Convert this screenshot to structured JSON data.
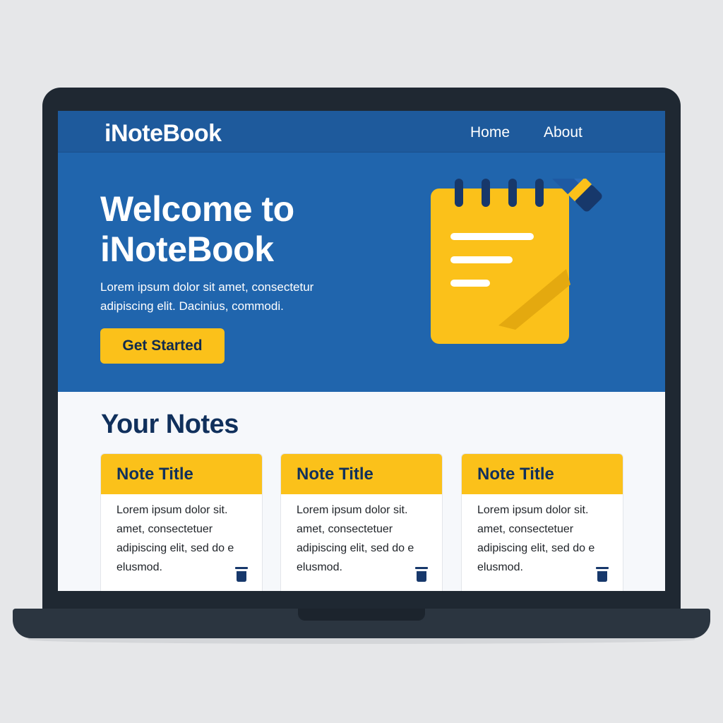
{
  "navbar": {
    "brand": "iNoteBook",
    "links": [
      {
        "label": "Home"
      },
      {
        "label": "About"
      }
    ]
  },
  "hero": {
    "title_line1": "Welcome to",
    "title_line2": "iNoteBook",
    "subtitle": "Lorem ipsum dolor sit amet, consectetur adipiscing elit. Dacinius, commodi.",
    "cta_label": "Get Started",
    "illustration_icon": "notepad-pencil-icon"
  },
  "notes_section": {
    "title": "Your Notes",
    "notes": [
      {
        "title": "Note Title",
        "body": "Lorem ipsum dolor sit. amet, consectetuer adipiscing elit, sed do e elusmod.",
        "action_icon": "trash-icon"
      },
      {
        "title": "Note Title",
        "body": "Lorem ipsum dolor sit. amet, consectetuer adipiscing elit, sed do e elusmod.",
        "action_icon": "trash-icon"
      },
      {
        "title": "Note Title",
        "body": "Lorem ipsum dolor sit. amet, consectetuer adipiscing elit, sed do e elusmod.",
        "action_icon": "trash-icon"
      }
    ]
  },
  "colors": {
    "navbar_bg": "#1e5a9c",
    "hero_bg": "#2065ad",
    "accent_yellow": "#fbc11a",
    "heading_navy": "#10305c",
    "laptop_frame": "#1f2832"
  }
}
